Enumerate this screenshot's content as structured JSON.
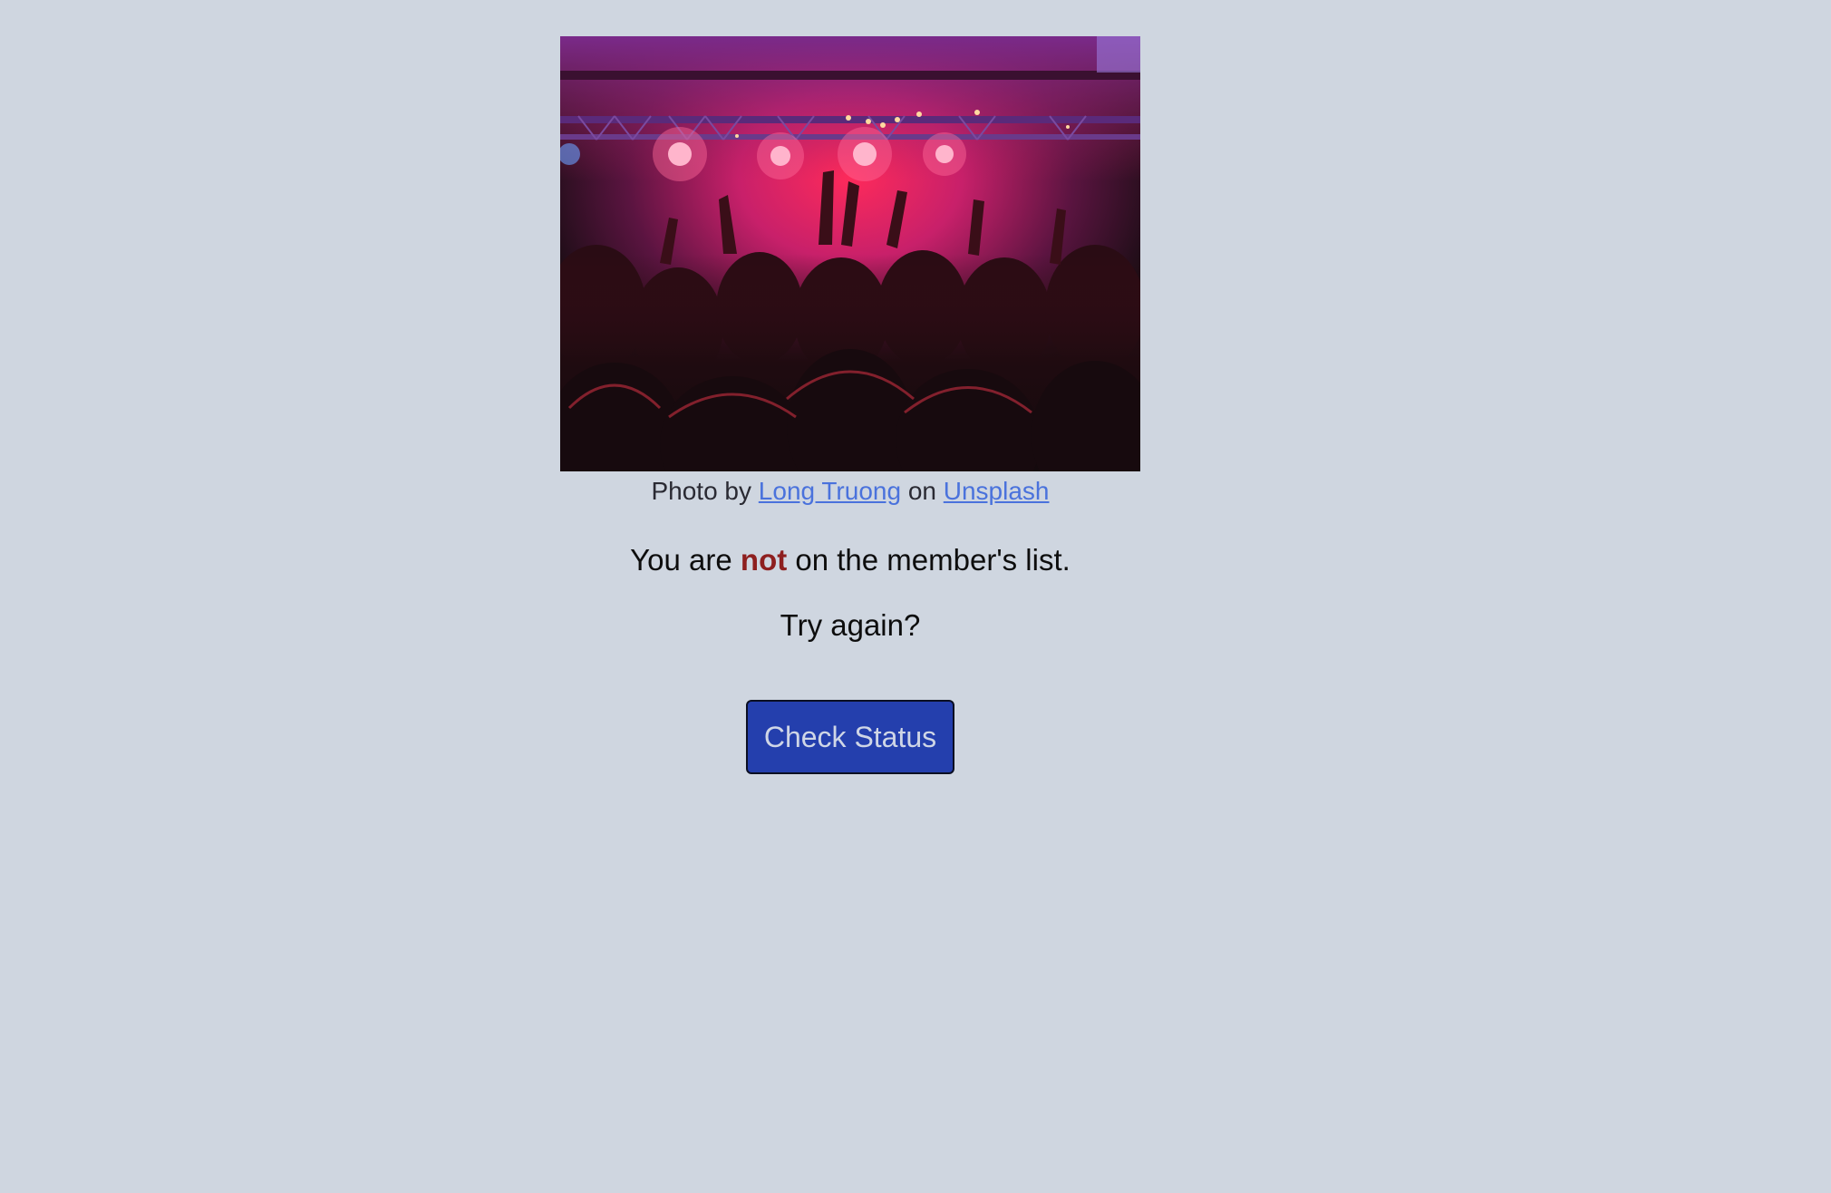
{
  "photo": {
    "description_icon": "concert-crowd-photo"
  },
  "credit": {
    "prefix": "Photo by",
    "author": "Long Truong",
    "middle": "on",
    "source": "Unsplash"
  },
  "status": {
    "before": "You are",
    "emphasis": "not",
    "after": "on the member's list."
  },
  "retry_text": "Try again?",
  "button": {
    "label": "Check Status"
  },
  "colors": {
    "background": "#cfd6e0",
    "link": "#4a72dc",
    "emphasis": "#8e1f1f",
    "button_bg": "#243fad",
    "button_text": "#cfd6e6"
  }
}
